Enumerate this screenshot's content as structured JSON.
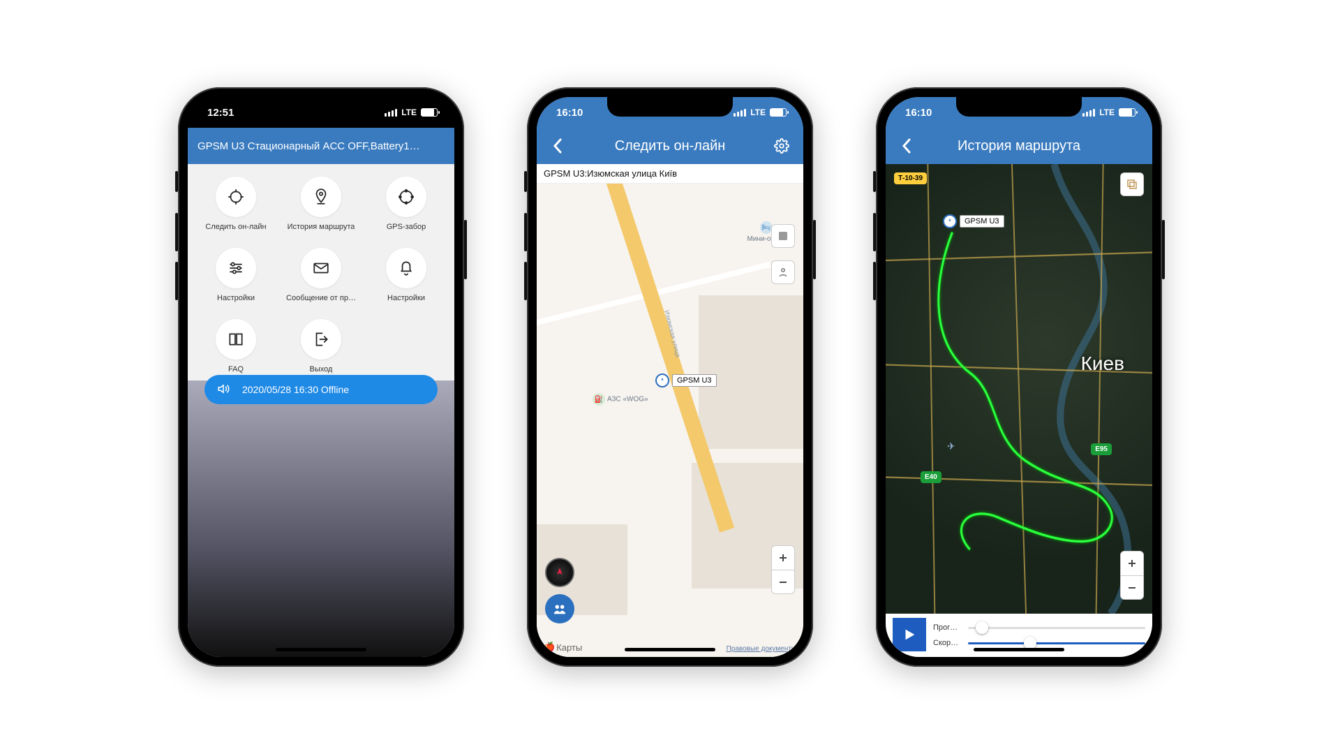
{
  "status": {
    "time1": "12:51",
    "time2": "16:10",
    "time3": "16:10",
    "net": "LTE"
  },
  "colors": {
    "brand": "#3a7bbf",
    "accent": "#1f8ae6"
  },
  "s1": {
    "title": "GPSM U3 Стационарный ACC OFF,Battery1…",
    "tiles": [
      {
        "id": "track-online",
        "label": "Следить он-лайн",
        "icon": "target"
      },
      {
        "id": "route-history",
        "label": "История маршрута",
        "icon": "pin"
      },
      {
        "id": "gps-fence",
        "label": "GPS-забор",
        "icon": "ring"
      },
      {
        "id": "settings",
        "label": "Настройки",
        "icon": "sliders"
      },
      {
        "id": "messages",
        "label": "Сообщение от пр…",
        "icon": "mail"
      },
      {
        "id": "alerts",
        "label": "Настройки",
        "icon": "bell"
      },
      {
        "id": "faq",
        "label": "FAQ",
        "icon": "book"
      },
      {
        "id": "logout",
        "label": "Выход",
        "icon": "exit"
      }
    ],
    "status_pill": "2020/05/28 16:30 Offline"
  },
  "s2": {
    "title": "Следить он-лайн",
    "subtitle": "GPSM U3:Изюмская улица Київ",
    "marker_label": "GPSM U3",
    "poi_hotel": "Мини-отель",
    "poi_gas": "АЗС «WOG»",
    "street": "Изюмская улица",
    "map_credit": "Карты",
    "legal": "Правовые документы"
  },
  "s3": {
    "title": "История маршрута",
    "marker_label": "GPSM U3",
    "city": "Киев",
    "road_badge": "Т-10-39",
    "hw1": "Е95",
    "hw2": "Е40",
    "slider_progress_label": "Прог…",
    "slider_speed_label": "Скор…",
    "progress_pct": 8,
    "speed_pct": 35
  }
}
